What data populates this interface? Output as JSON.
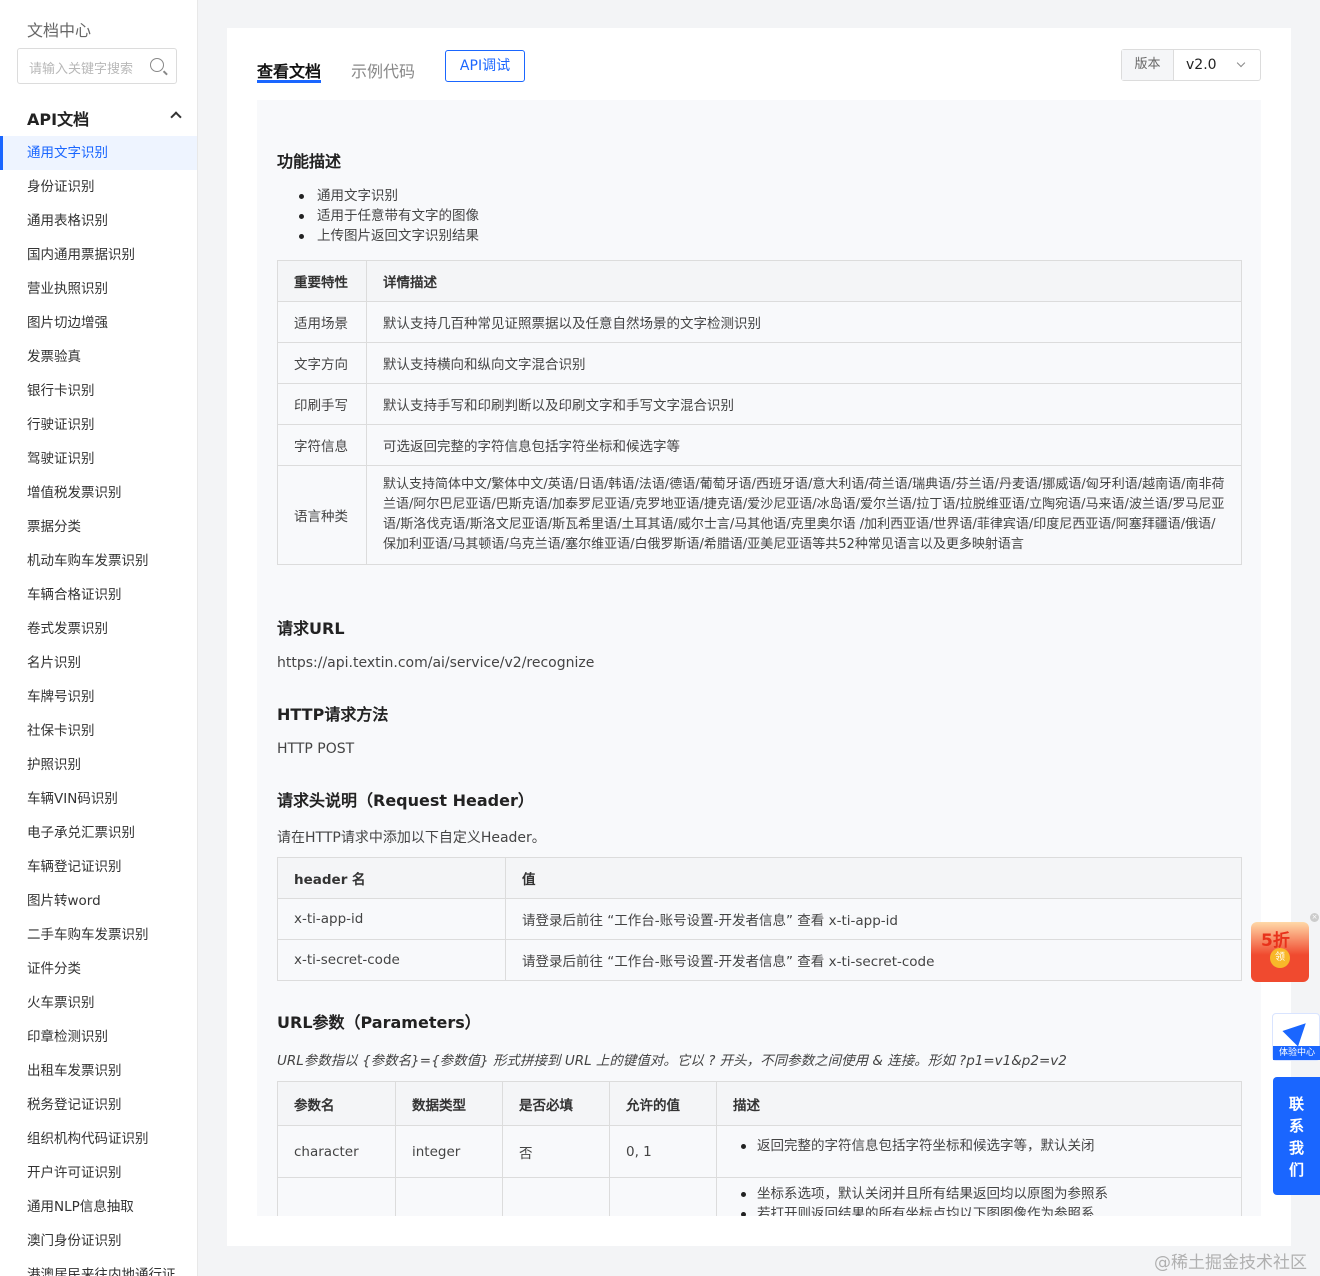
{
  "sidebar": {
    "title": "文档中心",
    "search_placeholder": "请输入关键字搜索",
    "section": "API文档",
    "items": [
      "通用文字识别",
      "身份证识别",
      "通用表格识别",
      "国内通用票据识别",
      "营业执照识别",
      "图片切边增强",
      "发票验真",
      "银行卡识别",
      "行驶证识别",
      "驾驶证识别",
      "增值税发票识别",
      "票据分类",
      "机动车购车发票识别",
      "车辆合格证识别",
      "卷式发票识别",
      "名片识别",
      "车牌号识别",
      "社保卡识别",
      "护照识别",
      "车辆VIN码识别",
      "电子承兑汇票识别",
      "车辆登记证识别",
      "图片转word",
      "二手车购车发票识别",
      "证件分类",
      "火车票识别",
      "印章检测识别",
      "出租车发票识别",
      "税务登记证识别",
      "组织机构代码证识别",
      "开户许可证识别",
      "通用NLP信息抽取",
      "澳门身份证识别",
      "港澳居民来往内地通行证"
    ]
  },
  "tabs": {
    "docs": "查看文档",
    "example": "示例代码",
    "debug": "API调试"
  },
  "version": {
    "label": "版本",
    "value": "v2.0"
  },
  "func": {
    "title": "功能描述",
    "bullets": [
      "通用文字识别",
      "适用于任意带有文字的图像",
      "上传图片返回文字识别结果"
    ],
    "table_head": [
      "重要特性",
      "详情描述"
    ],
    "rows": [
      [
        "适用场景",
        "默认支持几百种常见证照票据以及任意自然场景的文字检测识别"
      ],
      [
        "文字方向",
        "默认支持横向和纵向文字混合识别"
      ],
      [
        "印刷手写",
        "默认支持手写和印刷判断以及印刷文字和手写文字混合识别"
      ],
      [
        "字符信息",
        "可选返回完整的字符信息包括字符坐标和候选字等"
      ],
      [
        "语言种类",
        "默认支持简体中文/繁体中文/英语/日语/韩语/法语/德语/葡萄牙语/西班牙语/意大利语/荷兰语/瑞典语/芬兰语/丹麦语/挪威语/匈牙利语/越南语/南非荷兰语/阿尔巴尼亚语/巴斯克语/加泰罗尼亚语/克罗地亚语/捷克语/爱沙尼亚语/冰岛语/爱尔兰语/拉丁语/拉脱维亚语/立陶宛语/马来语/波兰语/罗马尼亚语/斯洛伐克语/斯洛文尼亚语/斯瓦希里语/土耳其语/威尔士言/马其他语/克里奥尔语 /加利西亚语/世界语/菲律宾语/印度尼西亚语/阿塞拜疆语/俄语/保加利亚语/马其顿语/乌克兰语/塞尔维亚语/白俄罗斯语/希腊语/亚美尼亚语等共52种常见语言以及更多映射语言"
      ]
    ]
  },
  "url": {
    "title": "请求URL",
    "value": "https://api.textin.com/ai/service/v2/recognize"
  },
  "method": {
    "title": "HTTP请求方法",
    "value": "HTTP POST"
  },
  "header": {
    "title": "请求头说明（Request Header）",
    "desc": "请在HTTP请求中添加以下自定义Header。",
    "table_head": [
      "header 名",
      "值"
    ],
    "rows": [
      [
        "x-ti-app-id",
        "请登录后前往 “工作台-账号设置-开发者信息” 查看 x-ti-app-id"
      ],
      [
        "x-ti-secret-code",
        "请登录后前往 “工作台-账号设置-开发者信息” 查看 x-ti-secret-code"
      ]
    ]
  },
  "params": {
    "title": "URL参数（Parameters）",
    "desc": "URL参数指以 {参数名}={参数值} 形式拼接到 URL 上的键值对。它以 ? 开头，不同参数之间使用 & 连接。形如 ?p1=v1&p2=v2",
    "table_head": [
      "参数名",
      "数据类型",
      "是否必填",
      "允许的值",
      "描述"
    ],
    "row1": [
      "character",
      "integer",
      "否",
      "0, 1",
      "返回完整的字符信息包括字符坐标和候选字等，默认关闭"
    ],
    "row2_desc": [
      "坐标系选项，默认关闭并且所有结果返回均以原图为参照系",
      "若打开则返回结果的所有坐标点均以下图图像作为参照系"
    ]
  },
  "floaters": {
    "promo": "5折",
    "promo_coin": "领",
    "experience": "体验中心",
    "contact": "联系我们"
  },
  "watermark": "@稀土掘金技术社区"
}
